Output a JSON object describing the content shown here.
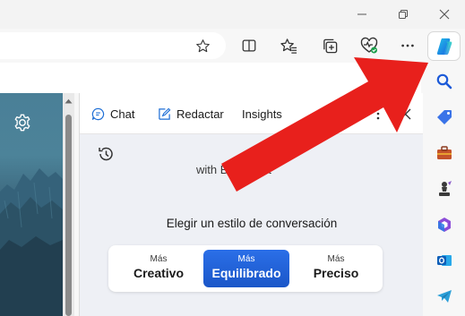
{
  "window_controls": {
    "minimize": "minimize-icon",
    "restore": "restore-icon",
    "close": "close-icon"
  },
  "toolbar": {
    "icons": [
      "favorite-star-icon",
      "split-screen-icon",
      "favorites-icon",
      "collections-icon",
      "browser-essentials-icon",
      "more-icon"
    ]
  },
  "pane": {
    "tabs": {
      "chat": "Chat",
      "compose": "Redactar",
      "insights": "Insights"
    },
    "behind_text": "with Bing Chat",
    "style_title": "Elegir un estilo de conversación",
    "styles": [
      {
        "small": "Más",
        "big": "Creativo",
        "active": false
      },
      {
        "small": "Más",
        "big": "Equilibrado",
        "active": true
      },
      {
        "small": "Más",
        "big": "Preciso",
        "active": false
      }
    ]
  },
  "sidebar": {
    "icons": [
      "copilot-icon",
      "search-icon",
      "shopping-tag-icon",
      "tools-icon",
      "games-icon",
      "microsoft-365-icon",
      "outlook-icon",
      "telegram-icon"
    ]
  },
  "colors": {
    "accent_blue": "#1a56c8",
    "arrow_red": "#e8201c"
  }
}
